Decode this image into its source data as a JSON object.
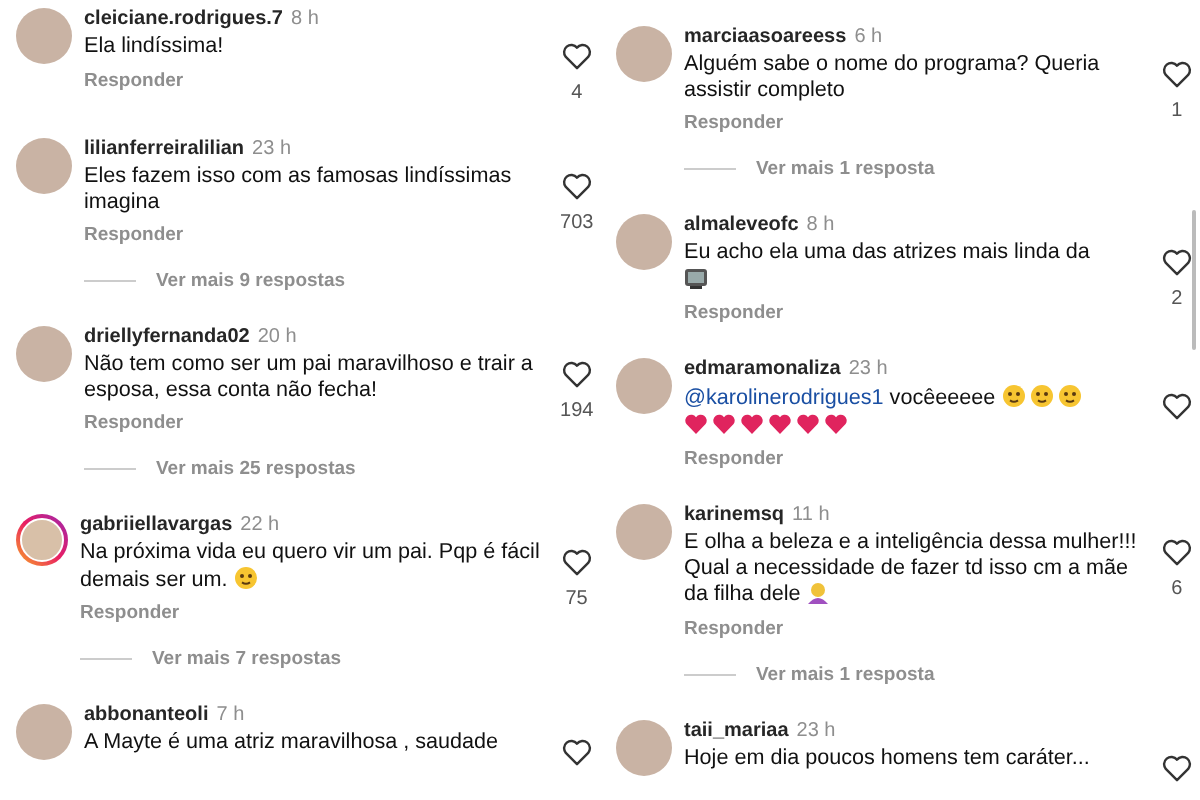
{
  "columns": [
    {
      "comments": [
        {
          "user": "cleiciane.rodrigues.7",
          "time": "8 h",
          "text": "Ela lindíssima!",
          "reply_label": "Responder",
          "likes": "4",
          "story_ring": false
        },
        {
          "user": "lilianferreiralilian",
          "time": "23 h",
          "text": "Eles fazem isso com as famosas lindíssimas imagina",
          "reply_label": "Responder",
          "likes": "703",
          "story_ring": false,
          "more_replies": "Ver mais 9 respostas"
        },
        {
          "user": "driellyfernanda02",
          "time": "20 h",
          "text": "Não tem como ser um pai maravilhoso e trair a esposa, essa conta não fecha!",
          "reply_label": "Responder",
          "likes": "194",
          "story_ring": false,
          "more_replies": "Ver mais 25 respostas"
        },
        {
          "user": "gabriiellavargas",
          "time": "22 h",
          "text": "Na próxima vida eu quero vir um pai. Pqp é fácil demais ser um.",
          "emoji": [
            {
              "kind": "face"
            }
          ],
          "reply_label": "Responder",
          "likes": "75",
          "story_ring": true,
          "more_replies": "Ver mais 7 respostas"
        },
        {
          "user": "abbonanteoli",
          "time": "7 h",
          "text": "A Mayte é uma atriz maravilhosa , saudade",
          "story_ring": false
        }
      ]
    },
    {
      "comments": [
        {
          "user": "marciaasoareess",
          "time": "6 h",
          "text": "Alguém sabe o nome do programa? Queria assistir completo",
          "reply_label": "Responder",
          "likes": "1",
          "story_ring": false,
          "more_replies": "Ver mais 1 resposta"
        },
        {
          "user": "almaleveofc",
          "time": "8 h",
          "text": "Eu acho ela uma das atrizes mais linda da",
          "emoji": [
            {
              "kind": "break"
            },
            {
              "kind": "tv"
            }
          ],
          "reply_label": "Responder",
          "likes": "2",
          "story_ring": false
        },
        {
          "user": "edmaramonaliza",
          "time": "23 h",
          "mention": "@karolinerodrigues1",
          "text": "vocêeeeee",
          "emoji": [
            {
              "kind": "face"
            },
            {
              "kind": "face"
            },
            {
              "kind": "face"
            },
            {
              "kind": "break"
            },
            {
              "kind": "heart"
            },
            {
              "kind": "heart"
            },
            {
              "kind": "heart"
            },
            {
              "kind": "heart"
            },
            {
              "kind": "heart"
            },
            {
              "kind": "heart"
            }
          ],
          "reply_label": "Responder",
          "story_ring": false
        },
        {
          "user": "karinemsq",
          "time": "11 h",
          "text": "E olha a beleza e a inteligência dessa mulher!!! Qual a necessidade de fazer td isso cm a mãe da filha dele",
          "emoji": [
            {
              "kind": "person"
            }
          ],
          "reply_label": "Responder",
          "likes": "6",
          "story_ring": false,
          "more_replies": "Ver mais 1 resposta"
        },
        {
          "user": "taii_mariaa",
          "time": "23 h",
          "text": "Hoje em dia poucos homens tem caráter...",
          "story_ring": false
        }
      ]
    }
  ]
}
